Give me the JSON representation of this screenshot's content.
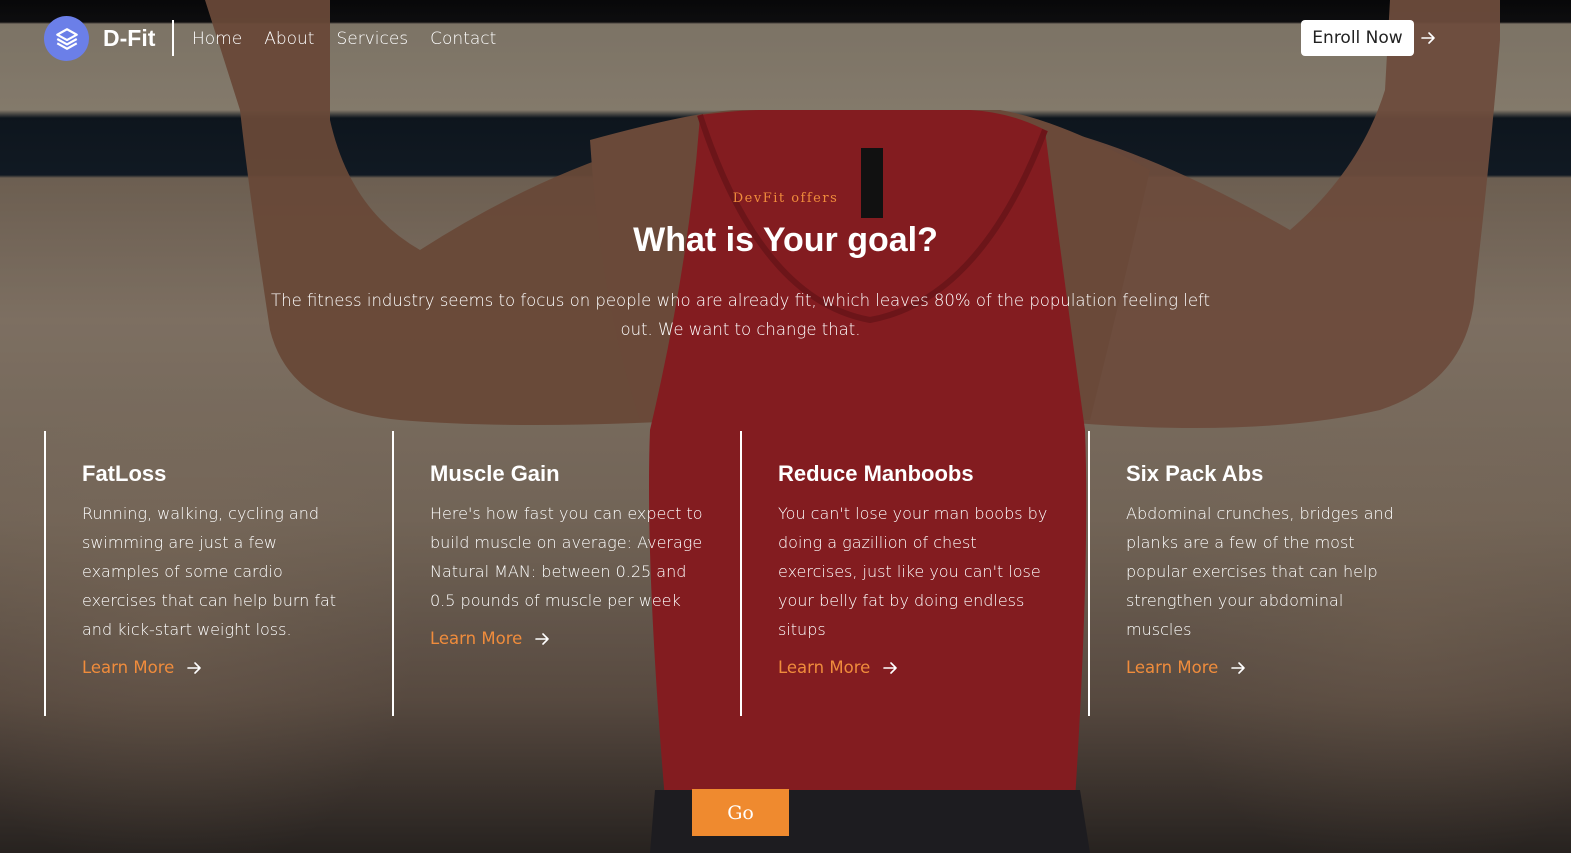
{
  "header": {
    "logo_icon": "stack-layers-icon",
    "logo_text": "D-Fit",
    "nav": [
      {
        "label": "Home"
      },
      {
        "label": "About"
      },
      {
        "label": "Services"
      },
      {
        "label": "Contact"
      }
    ],
    "enroll_label": "Enroll Now",
    "enroll_icon": "arrow-right-icon"
  },
  "hero": {
    "eyebrow": "DevFit offers",
    "title": "What is Your goal?",
    "description": "The fitness industry seems to focus on people who are already fit, which leaves 80% of the population feeling left out. We want to change that."
  },
  "cards": [
    {
      "title": "FatLoss",
      "text": "Running, walking, cycling and swimming are just a few examples of some cardio exercises that can help burn fat and kick-start weight loss.",
      "link_label": "Learn More"
    },
    {
      "title": "Muscle Gain",
      "text": "Here's how fast you can expect to build muscle on average: Average Natural MAN: between 0.25 and 0.5 pounds of muscle per week",
      "link_label": "Learn More"
    },
    {
      "title": "Reduce Manboobs",
      "text": "You can't lose your man boobs by doing a gazillion of chest exercises, just like you can't lose your belly fat by doing endless situps",
      "link_label": "Learn More"
    },
    {
      "title": "Six Pack Abs",
      "text": "Abdominal crunches, bridges and planks are a few of the most popular exercises that can help strengthen your abdominal muscles",
      "link_label": "Learn More"
    }
  ],
  "go_label": "Go",
  "colors": {
    "accent": "#ef8a2f",
    "logo": "#6b7fe8",
    "shirt": "#c22a30"
  }
}
